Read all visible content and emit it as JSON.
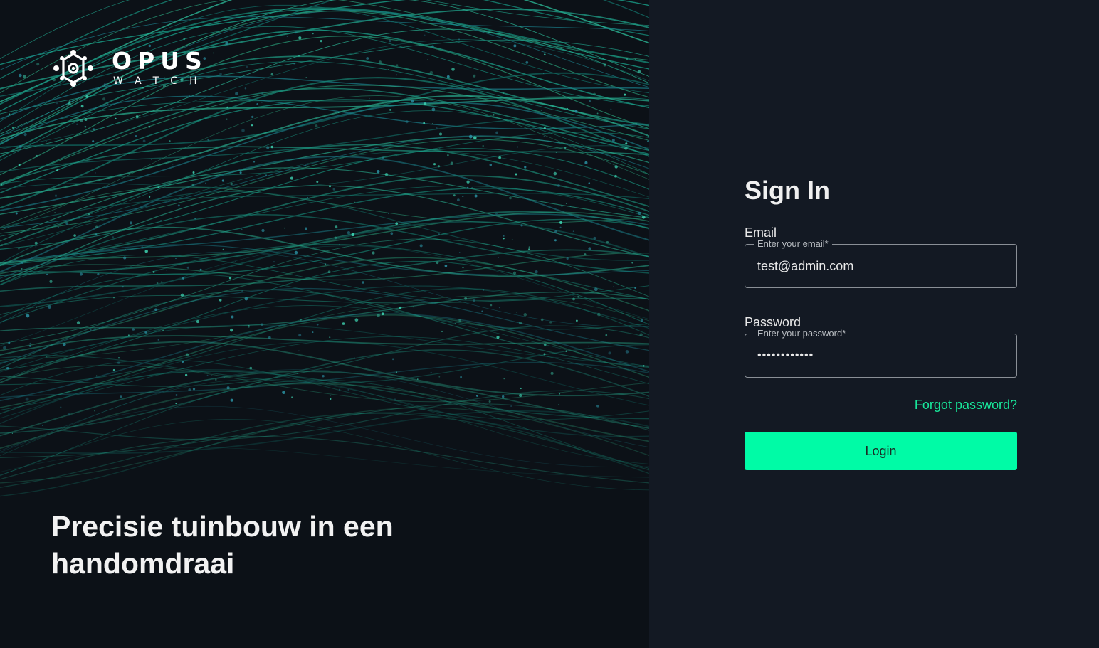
{
  "brand": {
    "name": "OPUS",
    "sub": "WATCH",
    "icon": "molecule-logo-icon"
  },
  "hero": {
    "tagline": "Precisie tuinbouw in een handomdraai"
  },
  "signin": {
    "title": "Sign In",
    "email": {
      "label": "Email",
      "legend": "Enter your email*",
      "value": "test@admin.com"
    },
    "password": {
      "label": "Password",
      "legend": "Enter your password*",
      "value": "••••••••••••"
    },
    "forgot_label": "Forgot password?",
    "login_label": "Login"
  },
  "colors": {
    "accent": "#00fba6",
    "link": "#18e69a",
    "panel_bg": "#131923",
    "hero_bg": "#0c1117"
  }
}
